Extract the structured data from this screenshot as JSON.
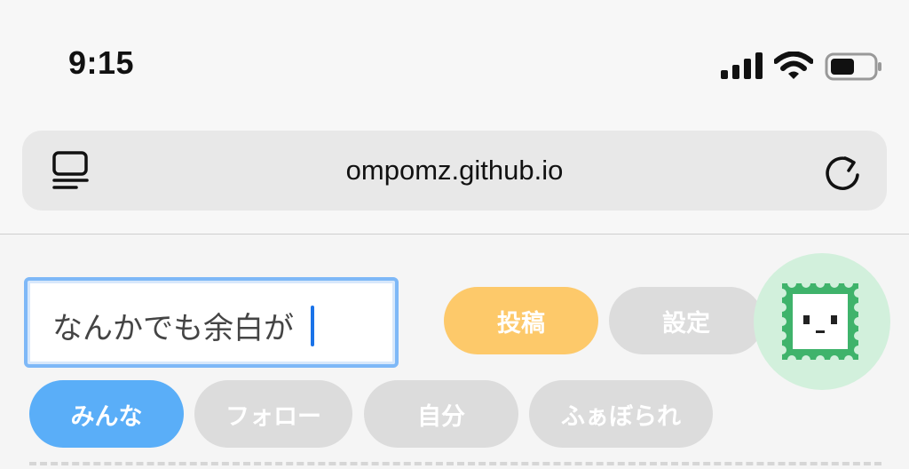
{
  "status_bar": {
    "time": "9:15",
    "icons": [
      "signal-icon",
      "wifi-icon",
      "battery-icon"
    ]
  },
  "browser": {
    "url": "ompomz.github.io",
    "icons": [
      "reader-mode-icon",
      "reload-icon"
    ]
  },
  "post_form": {
    "input_value": "なんかでも余白が",
    "post_label": "投稿",
    "settings_label": "設定"
  },
  "tabs": [
    {
      "label": "みんな",
      "active": true
    },
    {
      "label": "フォロー",
      "active": false
    },
    {
      "label": "自分",
      "active": false
    },
    {
      "label": "ふぁぼられ",
      "active": false
    }
  ],
  "avatar": {
    "icon": "stamp-face-icon"
  },
  "colors": {
    "accent_blue": "#5aaef8",
    "post_button": "#fdc96a",
    "inactive_pill": "#dcdcdc",
    "input_border": "#7eb8f7",
    "avatar_bg": "#d2f0dc",
    "stamp_green": "#3fb36b"
  }
}
